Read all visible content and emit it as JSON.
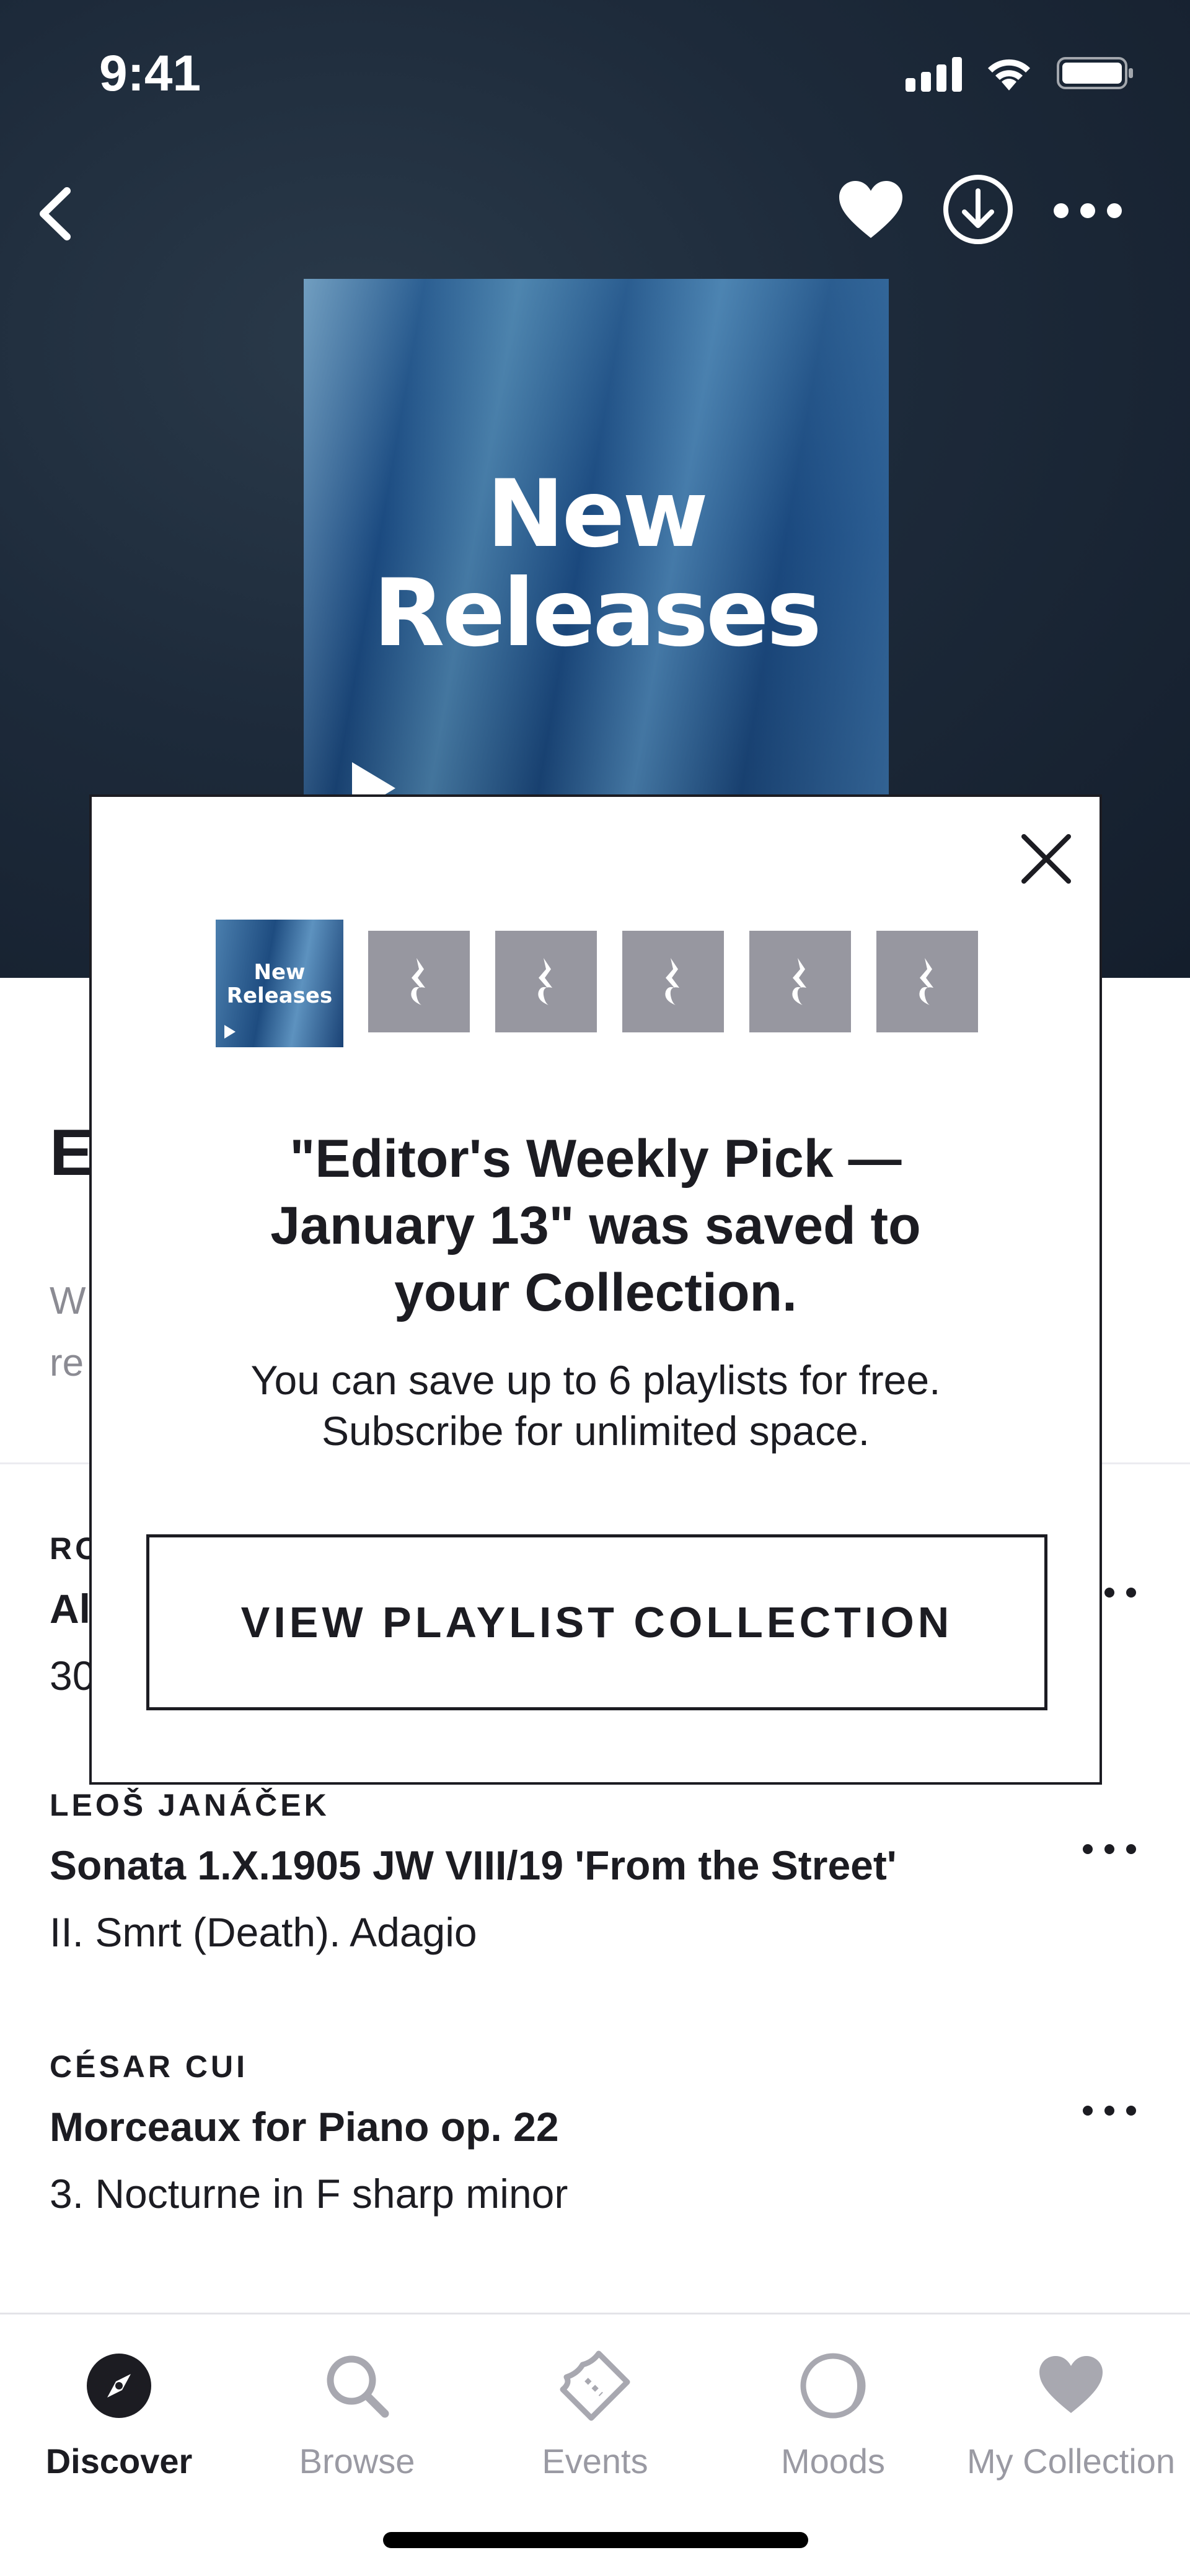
{
  "status_bar": {
    "time": "9:41"
  },
  "hero": {
    "cover_title_line1": "New",
    "cover_title_line2": "Releases"
  },
  "background": {
    "section_title": "E",
    "section_desc_line1": "W",
    "section_desc_line2": "re",
    "tracks": [
      {
        "composer": "RO",
        "work": "Al",
        "movement": "30"
      },
      {
        "composer": "LEOŠ JANÁČEK",
        "work": "Sonata 1.X.1905 JW VIII/19 'From the Street'",
        "movement": "II. Smrt (Death). Adagio"
      },
      {
        "composer": "CÉSAR CUI",
        "work": "Morceaux for Piano op. 22",
        "movement": "3. Nocturne in F sharp minor"
      }
    ]
  },
  "modal": {
    "saved_thumb_line1": "New",
    "saved_thumb_line2": "Releases",
    "empty_slots": 5,
    "title_line1": "\"Editor's Weekly Pick —",
    "title_line2": "January 13\" was saved to",
    "title_line3": "your Collection.",
    "body_line1": "You can save up to 6 playlists for free.",
    "body_line2": "Subscribe for unlimited space.",
    "button_label": "VIEW PLAYLIST COLLECTION"
  },
  "tabbar": {
    "tabs": [
      {
        "label": "Discover",
        "icon": "compass-icon",
        "active": true
      },
      {
        "label": "Browse",
        "icon": "search-icon",
        "active": false
      },
      {
        "label": "Events",
        "icon": "ticket-icon",
        "active": false
      },
      {
        "label": "Moods",
        "icon": "moon-icon",
        "active": false
      },
      {
        "label": "My Collection",
        "icon": "heart-icon",
        "active": false
      }
    ]
  },
  "colors": {
    "text_dark": "#1c1c22",
    "text_muted": "#9a9aa3",
    "placeholder_slot": "#9797a0",
    "hero_bg": "#1d2a3a"
  }
}
